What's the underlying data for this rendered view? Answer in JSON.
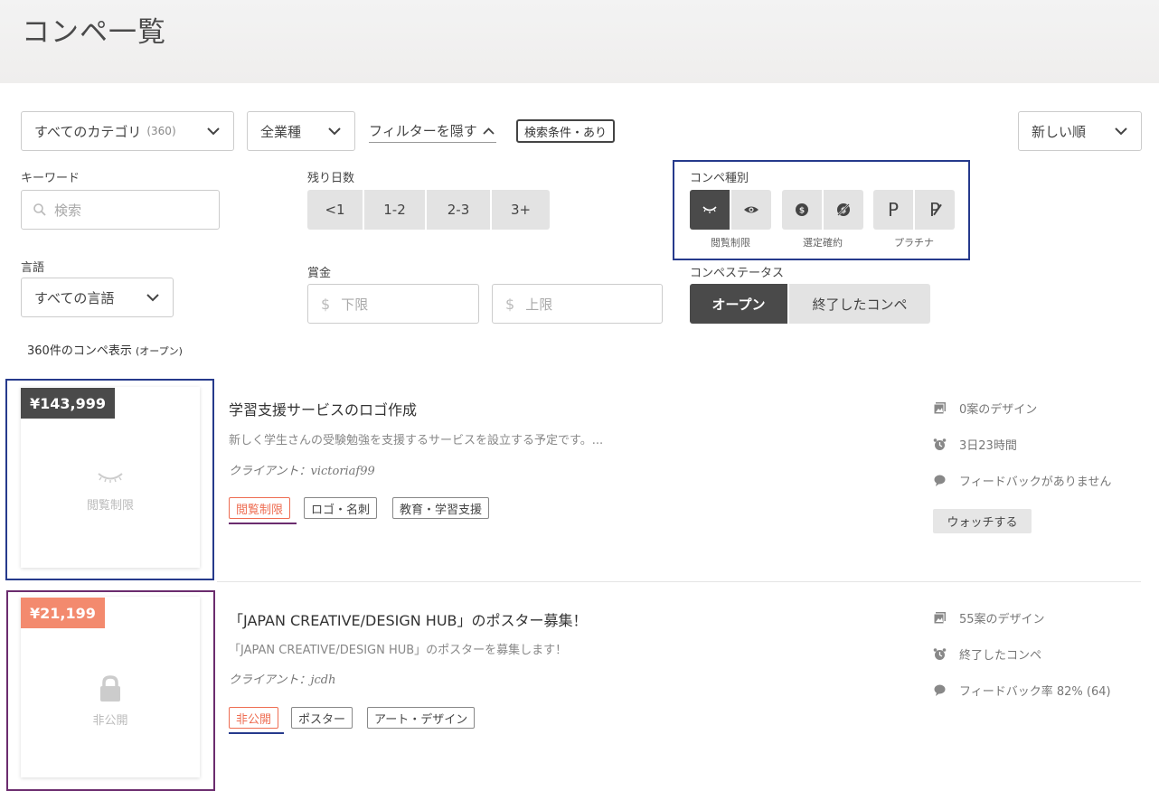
{
  "page": {
    "title": "コンペ一覧"
  },
  "filters": {
    "category": {
      "label": "すべてのカテゴリ",
      "count": "(360)"
    },
    "industry": {
      "label": "全業種"
    },
    "hide_filter": "フィルターを隠す",
    "search_badge": "検索条件・あり",
    "sort": {
      "label": "新しい順"
    },
    "keyword": {
      "label": "キーワード",
      "placeholder": "検索"
    },
    "days_left": {
      "label": "残り日数",
      "options": [
        "<1",
        "1-2",
        "2-3",
        "3+"
      ]
    },
    "compe_type": {
      "label": "コンペ種別",
      "groups": [
        "閲覧制限",
        "選定確約",
        "プラチナ"
      ],
      "platinum_symbols": [
        "P",
        "P"
      ]
    },
    "language": {
      "label": "言語",
      "value": "すべての言語"
    },
    "prize": {
      "label": "賞金",
      "currency": "$",
      "min_placeholder": "下限",
      "max_placeholder": "上限"
    },
    "status": {
      "label": "コンペステータス",
      "options": [
        "オープン",
        "終了したコンペ"
      ]
    }
  },
  "results": {
    "text": "360件のコンペ表示",
    "suffix": "(オープン)"
  },
  "contests": [
    {
      "price": "¥143,999",
      "price_color": "#4a4a4a",
      "thumb_label": "閲覧制限",
      "thumb_icon": "closed-eye-icon",
      "title": "学習支援サービスのロゴ作成",
      "description": "新しく学生さんの受験勉強を支援するサービスを設立する予定です。...",
      "client": "クライアント：victoriaf99",
      "tags": [
        "閲覧制限",
        "ロゴ・名刺",
        "教育・学習支援"
      ],
      "stats": [
        "0案のデザイン",
        "3日23時間",
        "フィードバックがありません"
      ],
      "watch_label": "ウォッチする",
      "frame_color": "#263a8c"
    },
    {
      "price": "¥21,199",
      "price_color": "#f38a6e",
      "thumb_label": "非公開",
      "thumb_icon": "lock-icon",
      "title": "「JAPAN CREATIVE/DESIGN HUB」のポスター募集！",
      "description": "「JAPAN CREATIVE/DESIGN HUB」のポスターを募集します！",
      "client": "クライアント：jcdh",
      "tags": [
        "非公開",
        "ポスター",
        "アート・デザイン"
      ],
      "stats": [
        "55案のデザイン",
        "終了したコンペ",
        "フィードバック率 82% (64)"
      ],
      "frame_color": "#6b2c6e"
    }
  ]
}
